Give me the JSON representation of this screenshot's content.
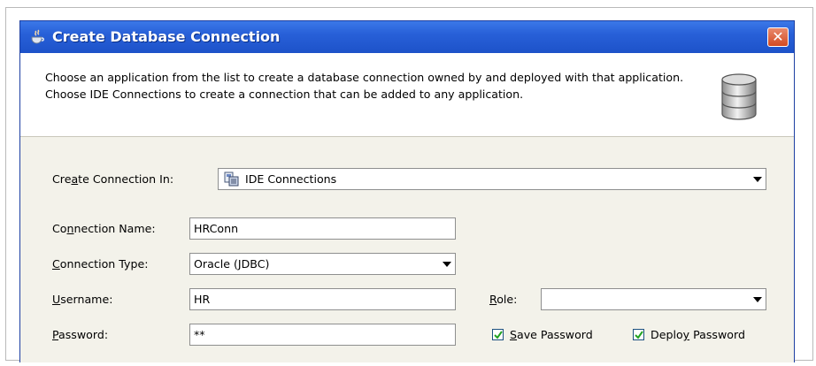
{
  "window": {
    "title": "Create Database Connection",
    "close_label": "✕"
  },
  "header": {
    "description": "Choose an application from the list to create a database connection owned by and deployed with that application. Choose IDE Connections to create a connection that can be added to any application."
  },
  "form": {
    "create_in": {
      "label_pre": "Cre",
      "label_u": "a",
      "label_post": "te Connection In:",
      "value": "IDE Connections"
    },
    "connection_name": {
      "label_pre": "Co",
      "label_u": "n",
      "label_post": "nection Name:",
      "value": "HRConn"
    },
    "connection_type": {
      "label_pre": "",
      "label_u": "C",
      "label_post": "onnection Type:",
      "value": "Oracle (JDBC)"
    },
    "username": {
      "label_pre": "",
      "label_u": "U",
      "label_post": "sername:",
      "value": "HR"
    },
    "password": {
      "label_pre": "",
      "label_u": "P",
      "label_post": "assword:",
      "value": "**"
    },
    "role": {
      "label_pre": "",
      "label_u": "R",
      "label_post": "ole:",
      "value": ""
    },
    "save_password": {
      "label_pre": "",
      "label_u": "S",
      "label_post": "ave Password",
      "checked": true
    },
    "deploy_password": {
      "label_pre": "Deplo",
      "label_u": "y",
      "label_post": " Password",
      "checked": true
    }
  },
  "icons": {
    "title": "java-cup-icon",
    "database": "database-icon",
    "connection": "connections-icon",
    "dropdown": "chevron-down-icon",
    "checkbox": "checkmark-icon"
  }
}
